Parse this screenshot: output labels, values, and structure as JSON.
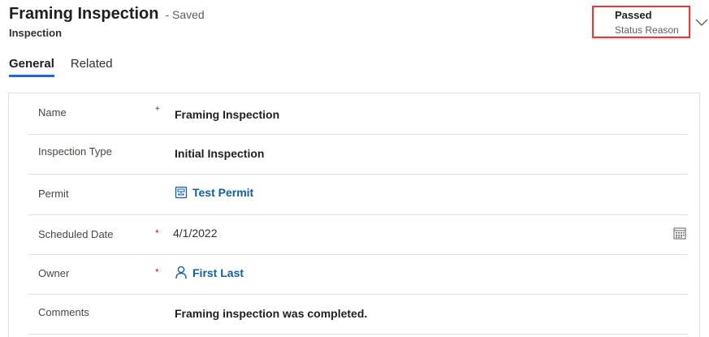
{
  "header": {
    "title": "Framing Inspection",
    "saved_status": "- Saved",
    "entity_name": "Inspection"
  },
  "status": {
    "value": "Passed",
    "label": "Status Reason",
    "highlight_color": "#e03c3c"
  },
  "tabs": [
    {
      "label": "General",
      "active": true
    },
    {
      "label": "Related",
      "active": false
    }
  ],
  "fields": {
    "name": {
      "label": "Name",
      "required": "+",
      "value": "Framing Inspection"
    },
    "inspection_type": {
      "label": "Inspection Type",
      "value": "Initial Inspection"
    },
    "permit": {
      "label": "Permit",
      "value": "Test Permit",
      "icon": "record-icon"
    },
    "scheduled_date": {
      "label": "Scheduled Date",
      "required": "*",
      "value": "4/1/2022",
      "icon": "calendar-icon"
    },
    "owner": {
      "label": "Owner",
      "required": "*",
      "value": "First Last",
      "icon": "person-icon"
    },
    "comments": {
      "label": "Comments",
      "value": "Framing inspection was completed."
    }
  },
  "colors": {
    "accent": "#2266e3",
    "link": "#115ea3",
    "required": "#a4262c"
  }
}
